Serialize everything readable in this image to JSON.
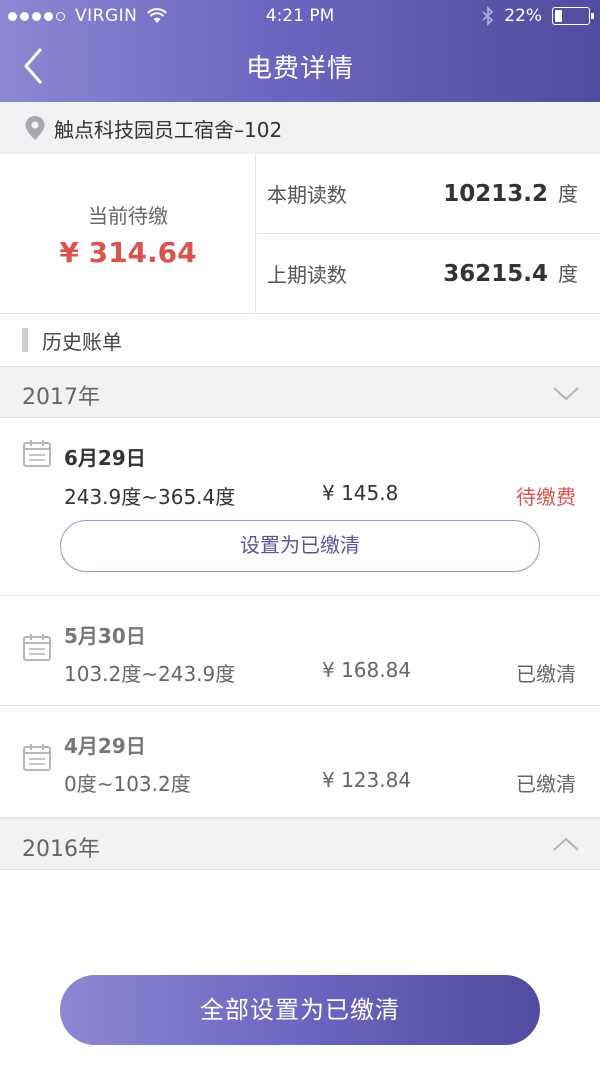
{
  "status_bar": {
    "carrier": "VIRGIN",
    "time": "4:21 PM",
    "battery_text": "22%",
    "battery_level": 0.22
  },
  "header": {
    "title": "电费详情",
    "back_icon": "chevron-left-icon"
  },
  "location": {
    "icon": "location-pin-icon",
    "text": "触点科技园员工宿舍–102"
  },
  "summary": {
    "due_label": "当前待缴",
    "due_amount": "¥ 314.64",
    "current_reading_label": "本期读数",
    "current_reading_value": "10213.2",
    "previous_reading_label": "上期读数",
    "previous_reading_value": "36215.4",
    "unit": "度"
  },
  "history": {
    "title": "历史账单",
    "years": [
      {
        "label": "2017年",
        "expanded": true,
        "bills": [
          {
            "date": "6月29日",
            "range": "243.9度~365.4度",
            "amount": "¥ 145.8",
            "status": "待缴费",
            "action_label": "设置为已缴清"
          },
          {
            "date": "5月30日",
            "range": "103.2度~243.9度",
            "amount": "¥ 168.84",
            "status": "已缴清"
          },
          {
            "date": "4月29日",
            "range": "0度~103.2度",
            "amount": "¥ 123.84",
            "status": "已缴清"
          }
        ]
      },
      {
        "label": "2016年",
        "expanded": false
      }
    ]
  },
  "footer": {
    "mark_all_label": "全部设置为已缴清"
  },
  "colors": {
    "accent_start": "#8d87d3",
    "accent_end": "#514c9f",
    "unpaid": "#d9534f"
  }
}
